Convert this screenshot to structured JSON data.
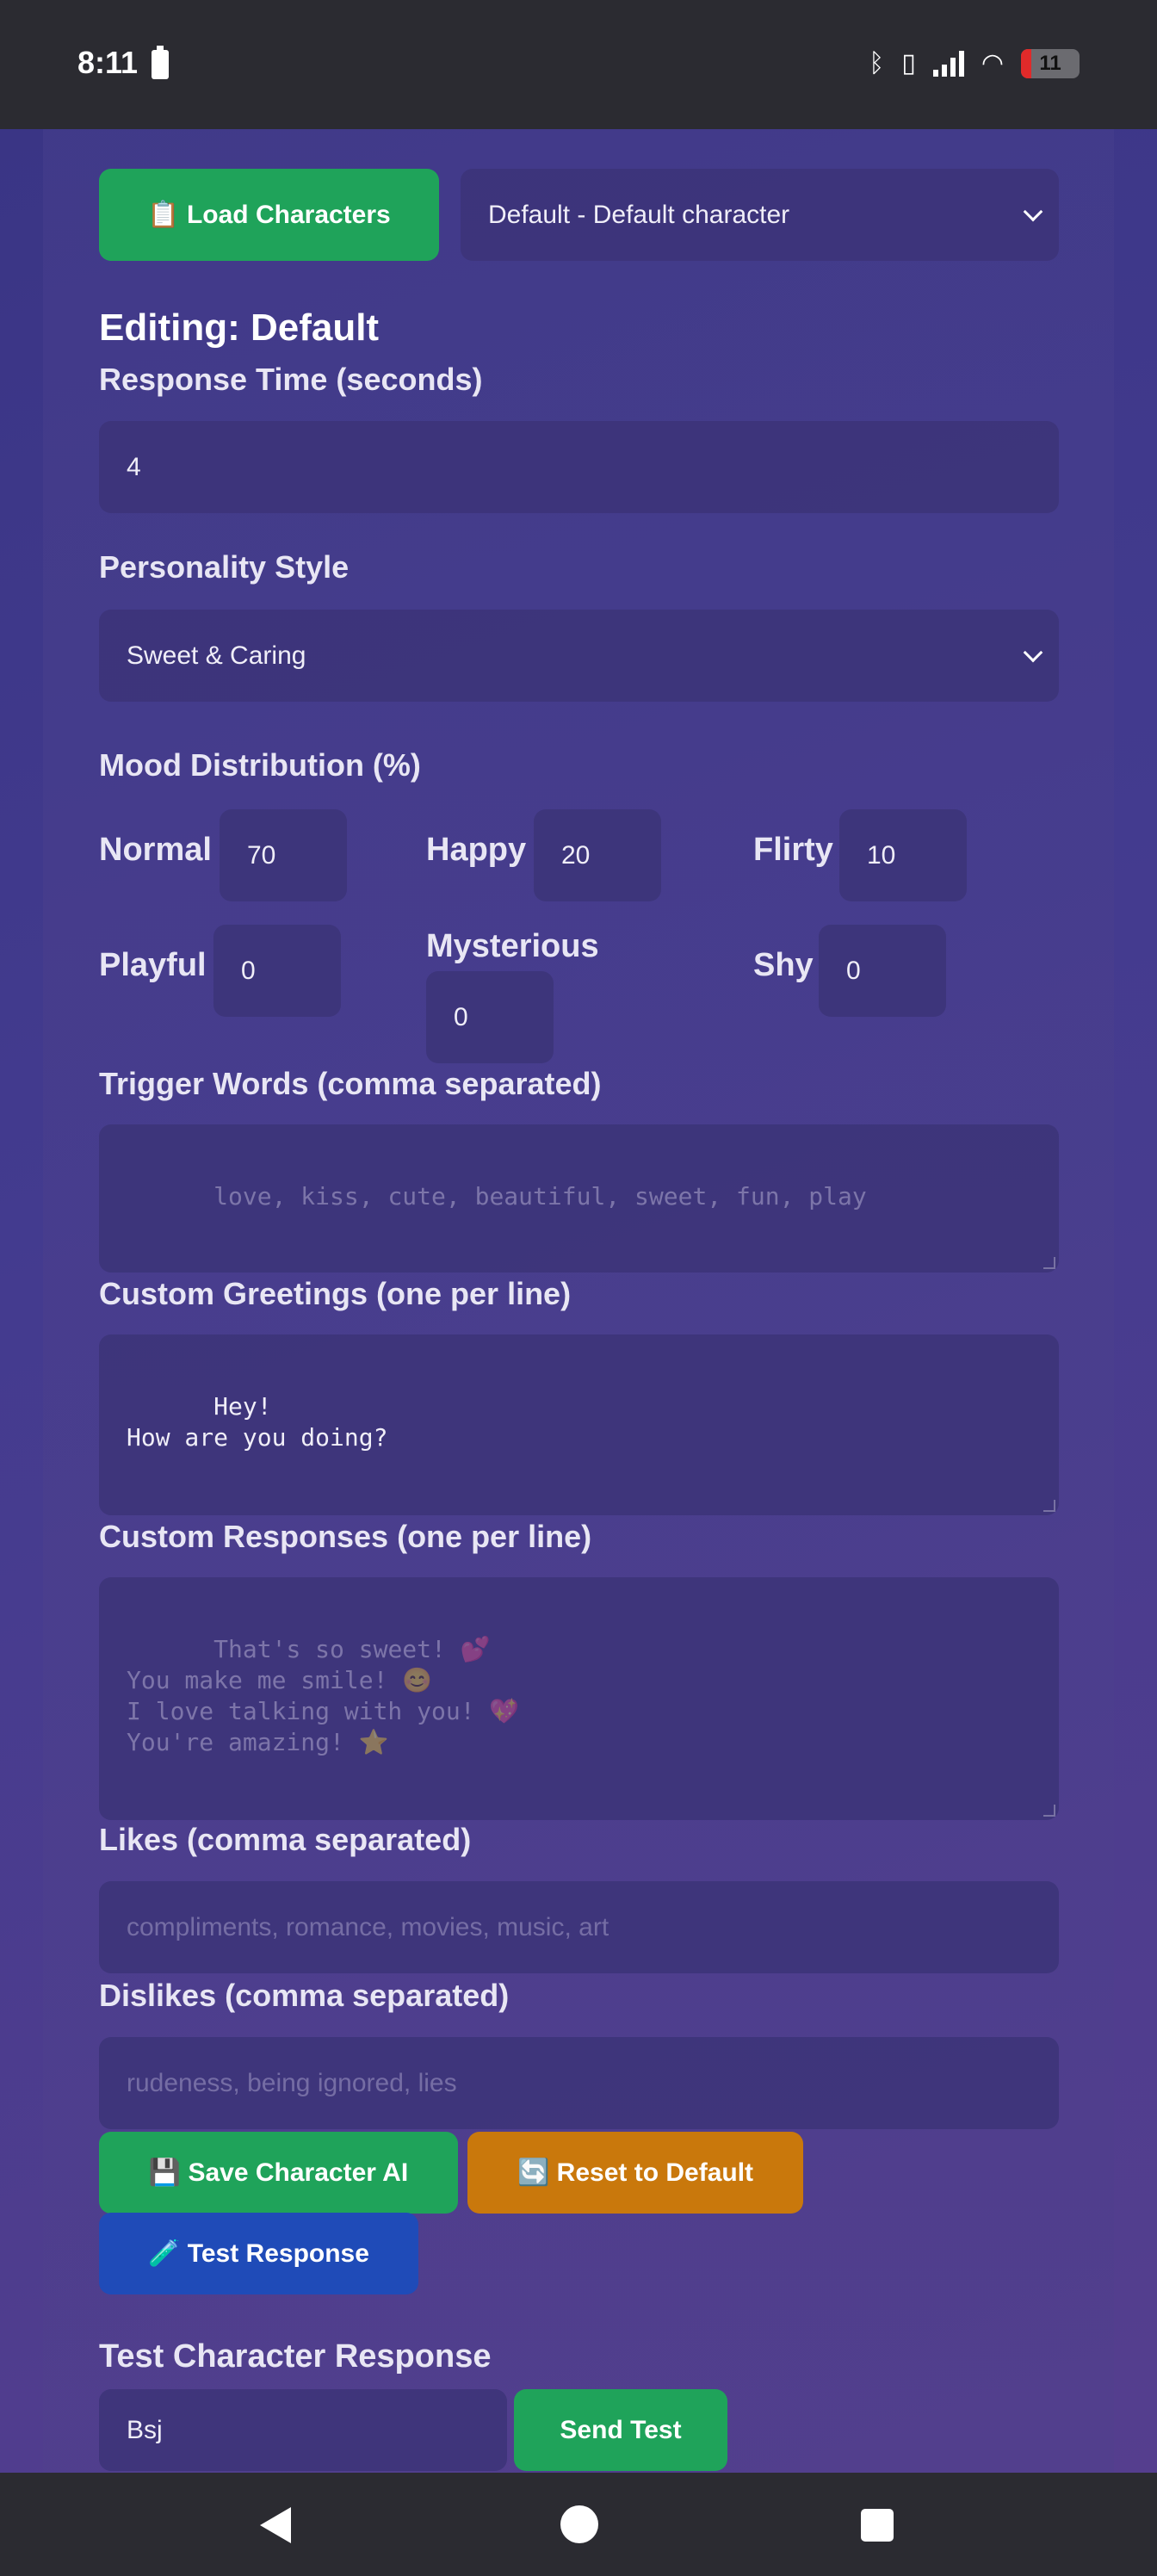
{
  "status": {
    "time": "8:11",
    "battery": "11"
  },
  "toolbar": {
    "load_label": "📋 Load Characters",
    "character_select": "Default - Default character"
  },
  "editing_title": "Editing: Default",
  "response_time": {
    "label": "Response Time (seconds)",
    "value": "4"
  },
  "personality": {
    "label": "Personality Style",
    "value": "Sweet & Caring"
  },
  "mood": {
    "label": "Mood Distribution (%)",
    "items": [
      {
        "name": "Normal",
        "value": "70"
      },
      {
        "name": "Happy",
        "value": "20"
      },
      {
        "name": "Flirty",
        "value": "10"
      },
      {
        "name": "Playful",
        "value": "0"
      },
      {
        "name": "Mysterious",
        "value": "0"
      },
      {
        "name": "Shy",
        "value": "0"
      }
    ]
  },
  "trigger_words": {
    "label": "Trigger Words (comma separated)",
    "placeholder": "love, kiss, cute, beautiful, sweet, fun, play"
  },
  "greetings": {
    "label": "Custom Greetings (one per line)",
    "value": "Hey!\nHow are you doing?"
  },
  "responses": {
    "label": "Custom Responses (one per line)",
    "placeholder": "That's so sweet! 💕\nYou make me smile! 😊\nI love talking with you! 💖\nYou're amazing! ⭐"
  },
  "likes": {
    "label": "Likes (comma separated)",
    "placeholder": "compliments, romance, movies, music, art"
  },
  "dislikes": {
    "label": "Dislikes (comma separated)",
    "placeholder": "rudeness, being ignored, lies"
  },
  "actions": {
    "save_label": "💾 Save Character AI",
    "reset_label": "🔄 Reset to Default",
    "test_label": "🧪 Test Response"
  },
  "test": {
    "title": "Test Character Response",
    "input_value": "Bsj",
    "send_label": "Send Test"
  }
}
